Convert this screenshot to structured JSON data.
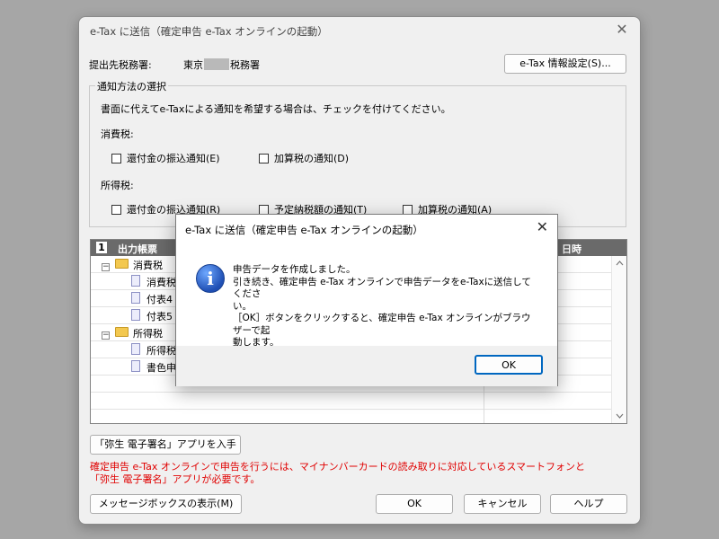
{
  "window": {
    "title": "e-Tax に送信（確定申告 e-Tax オンラインの起動）",
    "close_glyph": "✕"
  },
  "office": {
    "label": "提出先税務署:",
    "value_prefix": "東京",
    "value_suffix": "税務署",
    "settings_button": "e-Tax 情報設定(S)..."
  },
  "notice_group": {
    "legend": "通知方法の選択",
    "instruction": "書面に代えてe-Taxによる通知を希望する場合は、チェックを付けてください。",
    "consumption_tax": {
      "label": "消費税:",
      "options": [
        "還付金の振込通知(E)",
        "加算税の通知(D)"
      ]
    },
    "income_tax": {
      "label": "所得税:",
      "options": [
        "還付金の振込通知(R)",
        "予定納税額の通知(T)",
        "加算税の通知(A)"
      ]
    }
  },
  "tree": {
    "header_index": "1",
    "header_label": "出力帳票",
    "header_right": "日時",
    "rows": [
      {
        "label": "消費税",
        "type": "folder",
        "expanded": true
      },
      {
        "label": "消費税",
        "type": "doc"
      },
      {
        "label": "付表4",
        "type": "doc"
      },
      {
        "label": "付表5",
        "type": "doc"
      },
      {
        "label": "所得税",
        "type": "folder",
        "expanded": true
      },
      {
        "label": "所得税",
        "type": "doc"
      },
      {
        "label": "書色申",
        "type": "doc"
      }
    ],
    "expand_glyph": "−"
  },
  "app_button": "「弥生 電子署名」アプリを入手",
  "warning": {
    "line1": "確定申告 e-Tax オンラインで申告を行うには、マイナンバーカードの読み取りに対応しているスマートフォンと",
    "line2": "「弥生 電子署名」アプリが必要です。"
  },
  "footer": {
    "message_box_button": "メッセージボックスの表示(M)",
    "ok": "OK",
    "cancel": "キャンセル",
    "help": "ヘルプ"
  },
  "dialog": {
    "title": "e-Tax に送信（確定申告 e-Tax オンラインの起動）",
    "close_glyph": "✕",
    "icon_glyph": "i",
    "message_lines": [
      "申告データを作成しました。",
      "引き続き、確定申告 e-Tax オンラインで申告データをe-Taxに送信してくださ",
      "い。",
      "［OK］ボタンをクリックすると、確定申告 e-Tax オンラインがブラウザーで起",
      "動します。"
    ],
    "ok": "OK"
  },
  "colors": {
    "warning_text": "#e00000",
    "tree_header": "#6a6a6a",
    "info_icon": "#1f4fb4"
  }
}
